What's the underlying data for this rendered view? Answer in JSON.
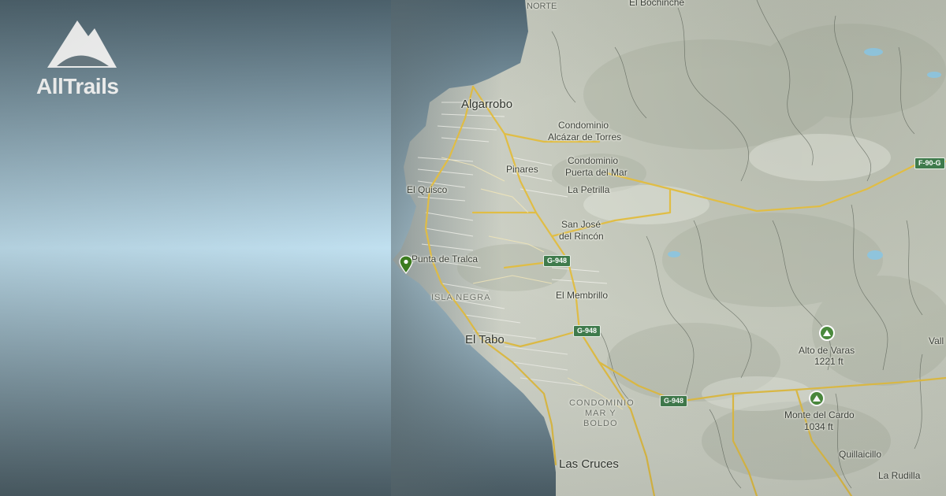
{
  "brand": {
    "name": "AllTrails",
    "logo_icon": "mountain-logo-icon",
    "logo_color": "#ffffff"
  },
  "map": {
    "sea_color_top": "#4f6570",
    "sea_color_mid": "#c2e2f2",
    "land_color": "#cfd3c7",
    "road_color": "#e6c34a",
    "places": {
      "norte": "NORTE",
      "el_bochinche": "El Bochinche",
      "algarrobo": "Algarrobo",
      "condominio_alcazar_1": "Condominio",
      "condominio_alcazar_2": "Alcázar de Torres",
      "condominio_puerta_1": "Condominio",
      "condominio_puerta_2": "Puerta del Mar",
      "pinares": "Pinares",
      "el_quisco": "El Quisco",
      "la_petrilla": "La Petrilla",
      "san_jose_1": "San José",
      "san_jose_2": "del Rincón",
      "punta_de_tralca": "Punta de Tralca",
      "isla_negra": "ISLA NEGRA",
      "el_membrillo": "El Membrillo",
      "el_tabo": "El Tabo",
      "condominio_mar_1": "CONDOMINIO",
      "condominio_mar_2": "MAR Y",
      "condominio_mar_3": "BOLDO",
      "las_cruces": "Las Cruces",
      "quillaicillo": "Quillaicillo",
      "la_rudilla": "La Rudilla",
      "vall": "Vall"
    },
    "peaks": [
      {
        "name": "Alto de Varas",
        "elevation": "1221 ft"
      },
      {
        "name": "Monte del Cardo",
        "elevation": "1034 ft"
      }
    ],
    "route_shields": {
      "g948_a": "G-948",
      "g948_b": "G-948",
      "g948_c": "G-948",
      "f90g": "F-90-G"
    },
    "marker": {
      "icon": "trail-pin-icon",
      "color": "#3d7d1f"
    }
  }
}
